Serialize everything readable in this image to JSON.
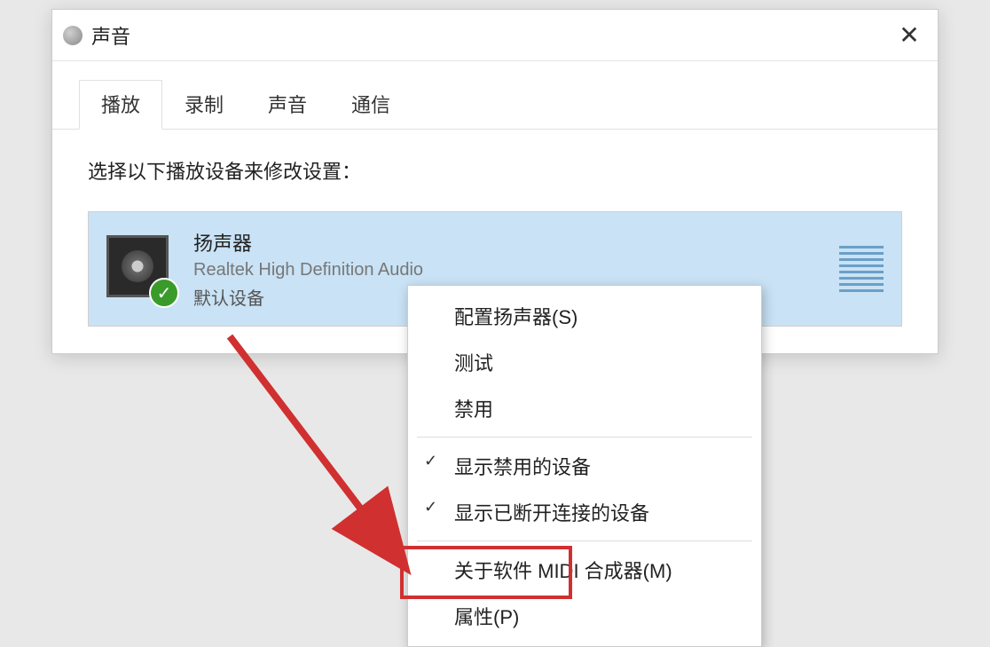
{
  "window": {
    "title": "声音"
  },
  "tabs": [
    {
      "label": "播放",
      "active": true
    },
    {
      "label": "录制",
      "active": false
    },
    {
      "label": "声音",
      "active": false
    },
    {
      "label": "通信",
      "active": false
    }
  ],
  "instruction": "选择以下播放设备来修改设置：",
  "device": {
    "name": "扬声器",
    "driver": "Realtek High Definition Audio",
    "status": "默认设备"
  },
  "context_menu": {
    "items": [
      {
        "label": "配置扬声器(S)",
        "type": "item"
      },
      {
        "label": "测试",
        "type": "item"
      },
      {
        "label": "禁用",
        "type": "item"
      },
      {
        "type": "sep"
      },
      {
        "label": "显示禁用的设备",
        "type": "checked"
      },
      {
        "label": "显示已断开连接的设备",
        "type": "checked"
      },
      {
        "type": "sep"
      },
      {
        "label": "关于软件 MIDI 合成器(M)",
        "type": "item"
      },
      {
        "label": "属性(P)",
        "type": "item"
      }
    ]
  }
}
